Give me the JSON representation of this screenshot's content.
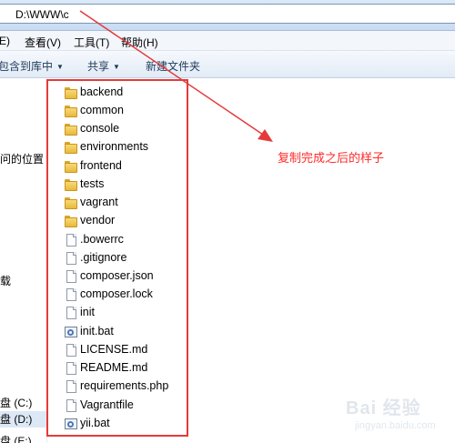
{
  "address_bar": {
    "path": "D:\\WWW\\c"
  },
  "menu": {
    "items": [
      {
        "label": "E)"
      },
      {
        "label": "查看(V)"
      },
      {
        "label": "工具(T)"
      },
      {
        "label": "帮助(H)"
      }
    ]
  },
  "command_bar": {
    "include_library": "包含到库中",
    "share": "共享",
    "new_folder": "新建文件夹"
  },
  "nav": {
    "items": [
      {
        "label": "问的位置"
      },
      {
        "label": "载"
      },
      {
        "label": "盘 (C:)"
      },
      {
        "label": "盘 (D:)"
      },
      {
        "label": "盘 (E:)"
      }
    ]
  },
  "files": [
    {
      "name": "backend",
      "icon": "folder-icon"
    },
    {
      "name": "common",
      "icon": "folder-icon"
    },
    {
      "name": "console",
      "icon": "folder-icon"
    },
    {
      "name": "environments",
      "icon": "folder-icon"
    },
    {
      "name": "frontend",
      "icon": "folder-icon"
    },
    {
      "name": "tests",
      "icon": "folder-icon"
    },
    {
      "name": "vagrant",
      "icon": "folder-icon"
    },
    {
      "name": "vendor",
      "icon": "folder-icon"
    },
    {
      "name": ".bowerrc",
      "icon": "document-icon"
    },
    {
      "name": ".gitignore",
      "icon": "document-icon"
    },
    {
      "name": "composer.json",
      "icon": "document-icon"
    },
    {
      "name": "composer.lock",
      "icon": "document-icon"
    },
    {
      "name": "init",
      "icon": "document-icon"
    },
    {
      "name": "init.bat",
      "icon": "batch-file-icon"
    },
    {
      "name": "LICENSE.md",
      "icon": "document-icon"
    },
    {
      "name": "README.md",
      "icon": "document-icon"
    },
    {
      "name": "requirements.php",
      "icon": "document-icon"
    },
    {
      "name": "Vagrantfile",
      "icon": "document-icon"
    },
    {
      "name": "yii.bat",
      "icon": "batch-file-icon"
    }
  ],
  "annotation": {
    "text": "复制完成之后的样子"
  },
  "watermark": {
    "text": "Bai 经验",
    "sub": "jingyan.baidu.com"
  },
  "colors": {
    "highlight": "#e53a3a",
    "annotation": "#ff2a2a",
    "folder": "#e8b93a"
  }
}
